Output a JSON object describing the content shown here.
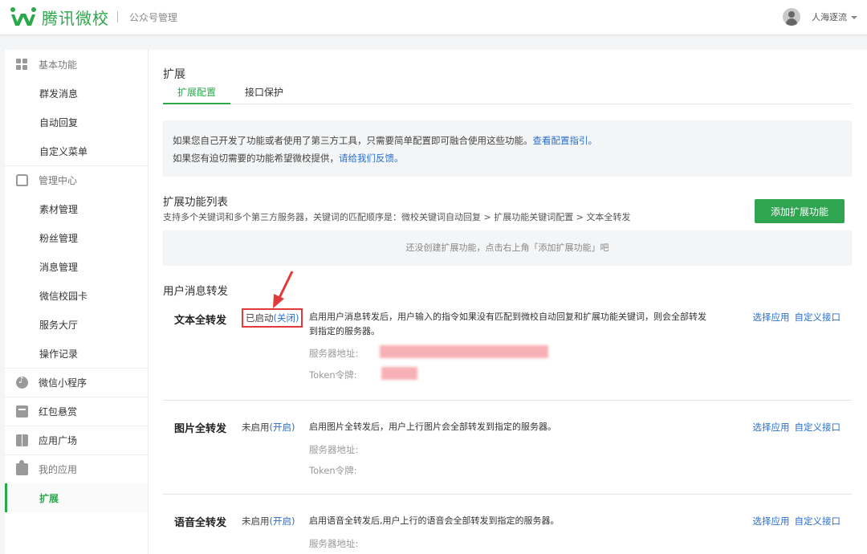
{
  "header": {
    "brand": "腾讯微校",
    "subtitle": "公众号管理",
    "user_name": "人海逐流"
  },
  "sidebar": {
    "groups": [
      {
        "label": "基本功能",
        "icon": "grid-icon",
        "items": [
          "群发消息",
          "自动回复",
          "自定义菜单"
        ]
      },
      {
        "label": "管理中心",
        "icon": "tray-icon",
        "items": [
          "素材管理",
          "粉丝管理",
          "消息管理",
          "微信校园卡",
          "服务大厅",
          "操作记录"
        ]
      },
      {
        "label": "微信小程序",
        "icon": "mini-program-icon"
      },
      {
        "label": "红包悬赏",
        "icon": "red-packet-icon"
      },
      {
        "label": "应用广场",
        "icon": "cube-icon"
      },
      {
        "label": "我的应用",
        "icon": "puzzle-icon",
        "items": [
          "扩展"
        ]
      }
    ]
  },
  "main": {
    "title": "扩展",
    "tabs": [
      "扩展配置",
      "接口保护"
    ],
    "notice": {
      "line1": "如果您自己开发了功能或者使用了第三方工具，只需要简单配置即可融合使用这些功能。",
      "line1_link": "查看配置指引。",
      "line2": "如果您有迫切需要的功能希望微校提供，",
      "line2_link": "请给我们反馈。"
    },
    "ext_list": {
      "title": "扩展功能列表",
      "desc": "支持多个关键词和多个第三方服务器，关键词的匹配顺序是：微校关键词自动回复 > 扩展功能关键词配置 > 文本全转发",
      "add_button": "添加扩展功能",
      "empty_text": "还没创建扩展功能，点击右上角「添加扩展功能」吧"
    },
    "forward": {
      "title": "用户消息转发",
      "rows": [
        {
          "name": "文本全转发",
          "status": "已启动",
          "toggle": "(关闭)",
          "desc": "启用用户消息转发后，用户输入的指令如果没有匹配到微校自动回复和扩展功能关键词，则会全部转发到指定的服务器。",
          "server_label": "服务器地址:",
          "token_label": "Token令牌:",
          "select_app": "选择应用",
          "custom_api": "自定义接口"
        },
        {
          "name": "图片全转发",
          "status": "未启用",
          "toggle": "(开启)",
          "desc": "启用图片全转发后，用户上行图片会全部转发到指定的服务器。",
          "server_label": "服务器地址:",
          "token_label": "Token令牌:",
          "select_app": "选择应用",
          "custom_api": "自定义接口"
        },
        {
          "name": "语音全转发",
          "status": "未启用",
          "toggle": "(开启)",
          "desc": "启用语音全转发后,用户上行的语音会全部转发到指定的服务器。",
          "server_label": "服务器地址:",
          "select_app": "选择应用",
          "custom_api": "自定义接口"
        }
      ]
    }
  },
  "colors": {
    "brand_green": "#2aa84a",
    "link_blue": "#2a6fcf",
    "highlight_red": "#e23a3a"
  }
}
